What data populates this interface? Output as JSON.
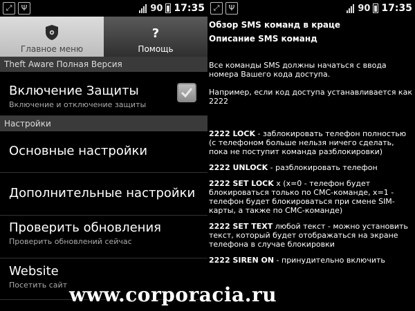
{
  "status_bar": {
    "battery": "90",
    "time": "17:35"
  },
  "tabs": [
    {
      "label": "Главное меню",
      "icon": "shield-icon"
    },
    {
      "label": "Помощь",
      "icon": "question-icon"
    }
  ],
  "sections": {
    "app_header": "Theft Aware Полная Версия",
    "settings_header": "Настройки"
  },
  "prefs": {
    "protection": {
      "title": "Включение Защиты",
      "summary": "Включение и отключение защиты",
      "checked": true
    },
    "basic": {
      "title": "Основные настройки"
    },
    "advanced": {
      "title": "Дополнительные настройки"
    },
    "update": {
      "title": "Проверить обновления",
      "summary": "Проверить обновлений сейчас"
    },
    "website": {
      "title": "Website",
      "summary": "Посетить сайт"
    }
  },
  "help": {
    "title": "Обзор SMS команд в краце",
    "subtitle": "Описание SMS команд",
    "intro": "Все команды SMS должны начаться с ввода номера Вашего кода доступа.",
    "example": "Например, если код доступа устанавливается как 2222",
    "commands": [
      {
        "cmd": "2222 LOCK",
        "desc": " - заблокировать телефон полностью (с телефоном больше нельзя ничего сделать, пока не поступит команда разблокировки)"
      },
      {
        "cmd": "2222 UNLOCK",
        "desc": " - разблокировать телефон"
      },
      {
        "cmd": "2222 SET LOCK",
        "desc": " x (x=0 - телефон будет блокироваться только по СМС-команде, x=1 - телефон будет блокироваться при смене SIM-карты, а также по СМС-команде)"
      },
      {
        "cmd": "2222 SET TEXT",
        "desc": " любой текст - можно установить текст, который будет отображаться на экране телефона в случае блокировки"
      },
      {
        "cmd": "2222 SIREN ON",
        "desc": " - принудительно включить"
      }
    ]
  },
  "watermark": "www.corporacia.ru"
}
